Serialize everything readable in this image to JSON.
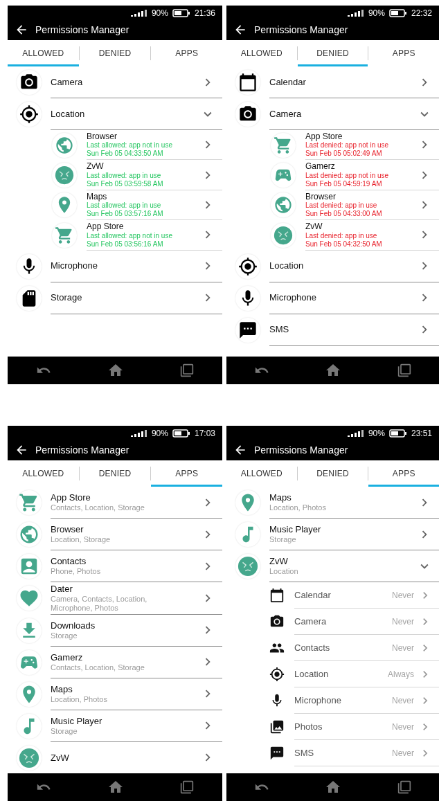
{
  "screens": [
    {
      "status_bar": {
        "battery": "90%",
        "time": "21:36"
      },
      "title": "Permissions Manager",
      "tabs": [
        {
          "label": "ALLOWED",
          "selected": true
        },
        {
          "label": "DENIED",
          "selected": false
        },
        {
          "label": "APPS",
          "selected": false
        }
      ],
      "items": [
        {
          "kind": "permission",
          "label": "Camera",
          "expanded": false
        },
        {
          "kind": "permission",
          "label": "Location",
          "expanded": true,
          "children": [
            {
              "kind": "allowed",
              "name": "Browser",
              "status": "Last allowed: app not in use",
              "time": "Sun Feb 05 04:33:50 AM"
            },
            {
              "kind": "allowed",
              "name": "ZvW",
              "status": "Last allowed: app in use",
              "time": "Sun Feb 05 03:59:58 AM"
            },
            {
              "kind": "allowed",
              "name": "Maps",
              "status": "Last allowed: app in use",
              "time": "Sun Feb 05 03:57:16 AM"
            },
            {
              "kind": "allowed",
              "name": "App Store",
              "status": "Last allowed: app not in use",
              "time": "Sun Feb 05 03:56:16 AM"
            }
          ]
        },
        {
          "kind": "permission",
          "label": "Microphone",
          "expanded": false
        },
        {
          "kind": "permission",
          "label": "Storage",
          "expanded": false
        }
      ]
    },
    {
      "status_bar": {
        "battery": "90%",
        "time": "22:32"
      },
      "title": "Permissions Manager",
      "tabs": [
        {
          "label": "ALLOWED",
          "selected": false
        },
        {
          "label": "DENIED",
          "selected": true
        },
        {
          "label": "APPS",
          "selected": false
        }
      ],
      "items": [
        {
          "kind": "permission",
          "label": "Calendar",
          "expanded": false
        },
        {
          "kind": "permission",
          "label": "Camera",
          "expanded": true,
          "children": [
            {
              "kind": "denied",
              "name": "App Store",
              "status": "Last denied: app not in use",
              "time": "Sun Feb 05 05:02:49 AM"
            },
            {
              "kind": "denied",
              "name": "Gamerz",
              "status": "Last denied: app not in use",
              "time": "Sun Feb 05 04:59:19 AM"
            },
            {
              "kind": "denied",
              "name": "Browser",
              "status": "Last denied: app in use",
              "time": "Sun Feb 05 04:33:00 AM"
            },
            {
              "kind": "denied",
              "name": "ZvW",
              "status": "Last denied: app in use",
              "time": "Sun Feb 05 04:32:50 AM"
            }
          ]
        },
        {
          "kind": "permission",
          "label": "Location",
          "expanded": false
        },
        {
          "kind": "permission",
          "label": "Microphone",
          "expanded": false
        },
        {
          "kind": "permission",
          "label": "SMS",
          "expanded": false
        }
      ]
    },
    {
      "status_bar": {
        "battery": "90%",
        "time": "17:03"
      },
      "title": "Permissions Manager",
      "tabs": [
        {
          "label": "ALLOWED",
          "selected": false
        },
        {
          "label": "DENIED",
          "selected": false
        },
        {
          "label": "APPS",
          "selected": true
        }
      ],
      "items": [
        {
          "kind": "app",
          "label": "App Store",
          "detail": "Contacts, Location, Storage",
          "expanded": false
        },
        {
          "kind": "app",
          "label": "Browser",
          "detail": "Location, Storage",
          "expanded": false
        },
        {
          "kind": "app",
          "label": "Contacts",
          "detail": "Phone, Photos",
          "expanded": false
        },
        {
          "kind": "app",
          "label": "Dater",
          "detail": "Camera, Contacts, Location, Microphone, Photos",
          "expanded": false
        },
        {
          "kind": "app",
          "label": "Downloads",
          "detail": "Storage",
          "expanded": false
        },
        {
          "kind": "app",
          "label": "Gamerz",
          "detail": "Contacts, Location, Storage",
          "expanded": false
        },
        {
          "kind": "app",
          "label": "Maps",
          "detail": "Location, Photos",
          "expanded": false
        },
        {
          "kind": "app",
          "label": "Music Player",
          "detail": "Storage",
          "expanded": false
        },
        {
          "kind": "app",
          "label": "ZvW",
          "expanded": false
        }
      ]
    },
    {
      "status_bar": {
        "battery": "90%",
        "time": "23:51"
      },
      "title": "Permissions Manager",
      "tabs": [
        {
          "label": "ALLOWED",
          "selected": false
        },
        {
          "label": "DENIED",
          "selected": false
        },
        {
          "label": "APPS",
          "selected": true
        }
      ],
      "items": [
        {
          "kind": "app",
          "label": "Maps",
          "detail": "Location, Photos",
          "expanded": false
        },
        {
          "kind": "app",
          "label": "Music Player",
          "detail": "Storage",
          "expanded": false
        },
        {
          "kind": "app",
          "label": "ZvW",
          "detail": "Location",
          "expanded": true,
          "children": [
            {
              "kind": "setting",
              "name": "Calendar",
              "value": "Never"
            },
            {
              "kind": "setting",
              "name": "Camera",
              "value": "Never"
            },
            {
              "kind": "setting",
              "name": "Contacts",
              "value": "Never"
            },
            {
              "kind": "setting",
              "name": "Location",
              "value": "Always"
            },
            {
              "kind": "setting",
              "name": "Microphone",
              "value": "Never"
            },
            {
              "kind": "setting",
              "name": "Photos",
              "value": "Never"
            },
            {
              "kind": "setting",
              "name": "SMS",
              "value": "Never"
            }
          ]
        }
      ]
    }
  ]
}
